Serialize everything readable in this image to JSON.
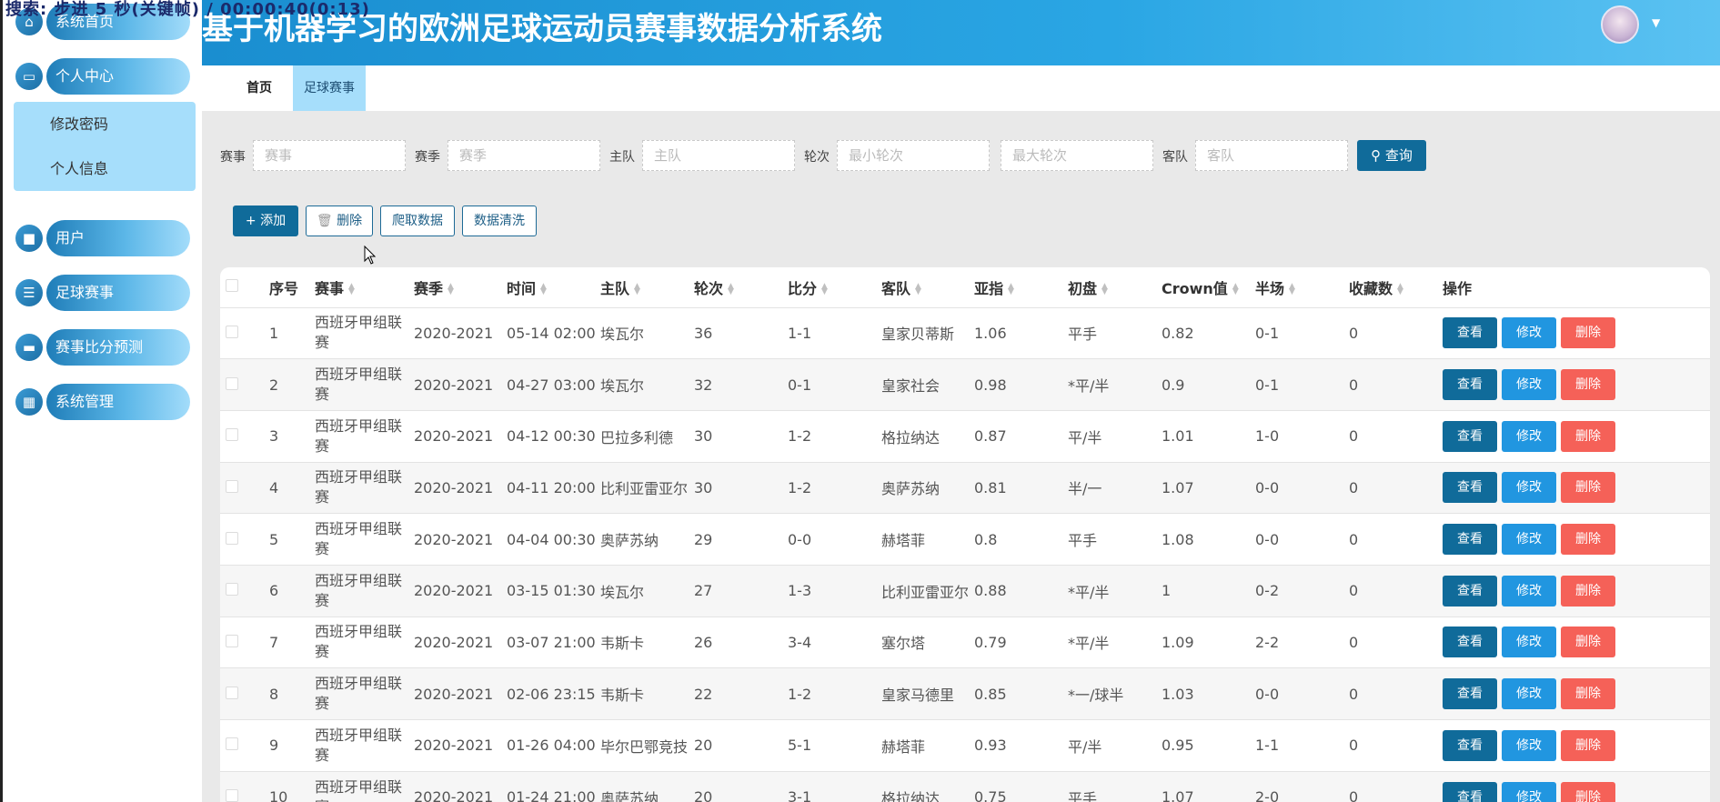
{
  "overlay_text": "搜索: 步进 5 秒(关键帧) / 00:00:40(0:13)",
  "app": {
    "title": "基于机器学习的欧洲足球运动员赛事数据分析系统"
  },
  "sidebar": {
    "items": [
      {
        "label": "系统首页",
        "icon": "home-icon"
      },
      {
        "label": "个人中心",
        "icon": "wallet-icon"
      },
      {
        "label": "用户",
        "icon": "briefcase-icon"
      },
      {
        "label": "足球赛事",
        "icon": "list-icon"
      },
      {
        "label": "赛事比分预测",
        "icon": "ticket-icon"
      },
      {
        "label": "系统管理",
        "icon": "grid-icon"
      }
    ],
    "submenu": [
      "修改密码",
      "个人信息"
    ]
  },
  "tabs": [
    {
      "label": "首页"
    },
    {
      "label": "足球赛事"
    }
  ],
  "search": {
    "fields": [
      {
        "label": "赛事",
        "placeholder": "赛事"
      },
      {
        "label": "赛季",
        "placeholder": "赛季"
      },
      {
        "label": "主队",
        "placeholder": "主队"
      },
      {
        "label": "轮次",
        "placeholder": "最小轮次"
      },
      {
        "label": "",
        "placeholder": "最大轮次"
      },
      {
        "label": "客队",
        "placeholder": "客队"
      }
    ],
    "query_label": "查询"
  },
  "actions": {
    "add": "添加",
    "delete": "删除",
    "crawl": "爬取数据",
    "clean": "数据清洗"
  },
  "table": {
    "headers": [
      "序号",
      "赛事",
      "赛季",
      "时间",
      "主队",
      "轮次",
      "比分",
      "客队",
      "亚指",
      "初盘",
      "Crown值",
      "半场",
      "收藏数",
      "操作"
    ],
    "rows": [
      [
        "1",
        "西班牙甲组联赛",
        "2020-2021",
        "05-14 02:00",
        "埃瓦尔",
        "36",
        "1-1",
        "皇家贝蒂斯",
        "1.06",
        "平手",
        "0.82",
        "0-1",
        "0"
      ],
      [
        "2",
        "西班牙甲组联赛",
        "2020-2021",
        "04-27 03:00",
        "埃瓦尔",
        "32",
        "0-1",
        "皇家社会",
        "0.98",
        "*平/半",
        "0.9",
        "0-1",
        "0"
      ],
      [
        "3",
        "西班牙甲组联赛",
        "2020-2021",
        "04-12 00:30",
        "巴拉多利德",
        "30",
        "1-2",
        "格拉纳达",
        "0.87",
        "平/半",
        "1.01",
        "1-0",
        "0"
      ],
      [
        "4",
        "西班牙甲组联赛",
        "2020-2021",
        "04-11 20:00",
        "比利亚雷亚尔",
        "30",
        "1-2",
        "奥萨苏纳",
        "0.81",
        "半/一",
        "1.07",
        "0-0",
        "0"
      ],
      [
        "5",
        "西班牙甲组联赛",
        "2020-2021",
        "04-04 00:30",
        "奥萨苏纳",
        "29",
        "0-0",
        "赫塔菲",
        "0.8",
        "平手",
        "1.08",
        "0-0",
        "0"
      ],
      [
        "6",
        "西班牙甲组联赛",
        "2020-2021",
        "03-15 01:30",
        "埃瓦尔",
        "27",
        "1-3",
        "比利亚雷亚尔",
        "0.88",
        "*平/半",
        "1",
        "0-2",
        "0"
      ],
      [
        "7",
        "西班牙甲组联赛",
        "2020-2021",
        "03-07 21:00",
        "韦斯卡",
        "26",
        "3-4",
        "塞尔塔",
        "0.79",
        "*平/半",
        "1.09",
        "2-2",
        "0"
      ],
      [
        "8",
        "西班牙甲组联赛",
        "2020-2021",
        "02-06 23:15",
        "韦斯卡",
        "22",
        "1-2",
        "皇家马德里",
        "0.85",
        "*一/球半",
        "1.03",
        "0-0",
        "0"
      ],
      [
        "9",
        "西班牙甲组联赛",
        "2020-2021",
        "01-26 04:00",
        "毕尔巴鄂竞技",
        "20",
        "5-1",
        "赫塔菲",
        "0.93",
        "平/半",
        "0.95",
        "1-1",
        "0"
      ],
      [
        "10",
        "西班牙甲组联赛",
        "2020-2021",
        "01-24 21:00",
        "奥萨苏纳",
        "20",
        "3-1",
        "格拉纳达",
        "0.75",
        "平手",
        "1.07",
        "2-0",
        "0"
      ]
    ],
    "row_actions": {
      "view": "查看",
      "edit": "修改",
      "delete": "删除"
    }
  },
  "colors": {
    "primary": "#106b9a",
    "edit": "#2196e0",
    "danger": "#f56158",
    "submenu_bg": "#a6defb"
  }
}
